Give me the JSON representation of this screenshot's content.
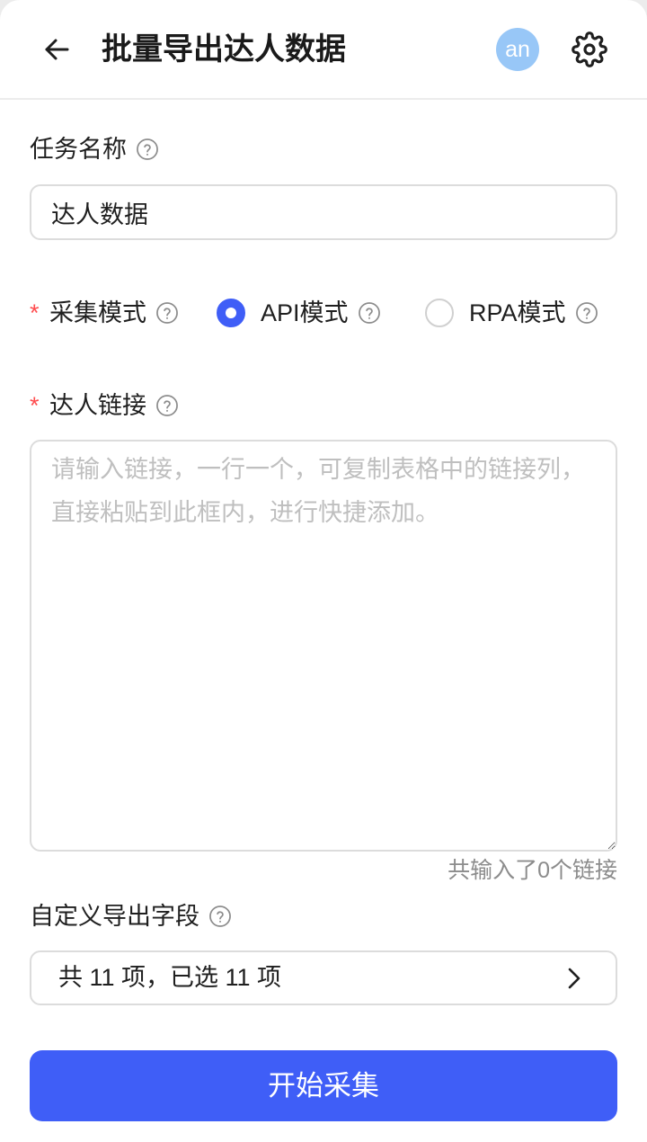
{
  "header": {
    "title": "批量导出达人数据",
    "avatar_text": "an",
    "back_icon": "arrow-left-icon",
    "settings_icon": "gear-icon"
  },
  "task_name": {
    "label": "任务名称",
    "value": "达人数据",
    "help_icon": "question-circle-icon"
  },
  "collect_mode": {
    "required_mark": "*",
    "label": "采集模式",
    "options": [
      {
        "label": "API模式",
        "selected": true
      },
      {
        "label": "RPA模式",
        "selected": false
      }
    ]
  },
  "links": {
    "required_mark": "*",
    "label": "达人链接",
    "placeholder": "请输入链接，一行一个，可复制表格中的链接列，直接粘贴到此框内，进行快捷添加。",
    "value": "",
    "count_text": "共输入了0个链接"
  },
  "export_fields": {
    "label": "自定义导出字段",
    "summary": "共 11 项，已选 11 项",
    "chevron_icon": "chevron-right-icon"
  },
  "submit": {
    "label": "开始采集"
  },
  "colors": {
    "primary": "#3f5ef7",
    "required": "#ff4d4f",
    "avatar_bg": "#98c7f7"
  }
}
